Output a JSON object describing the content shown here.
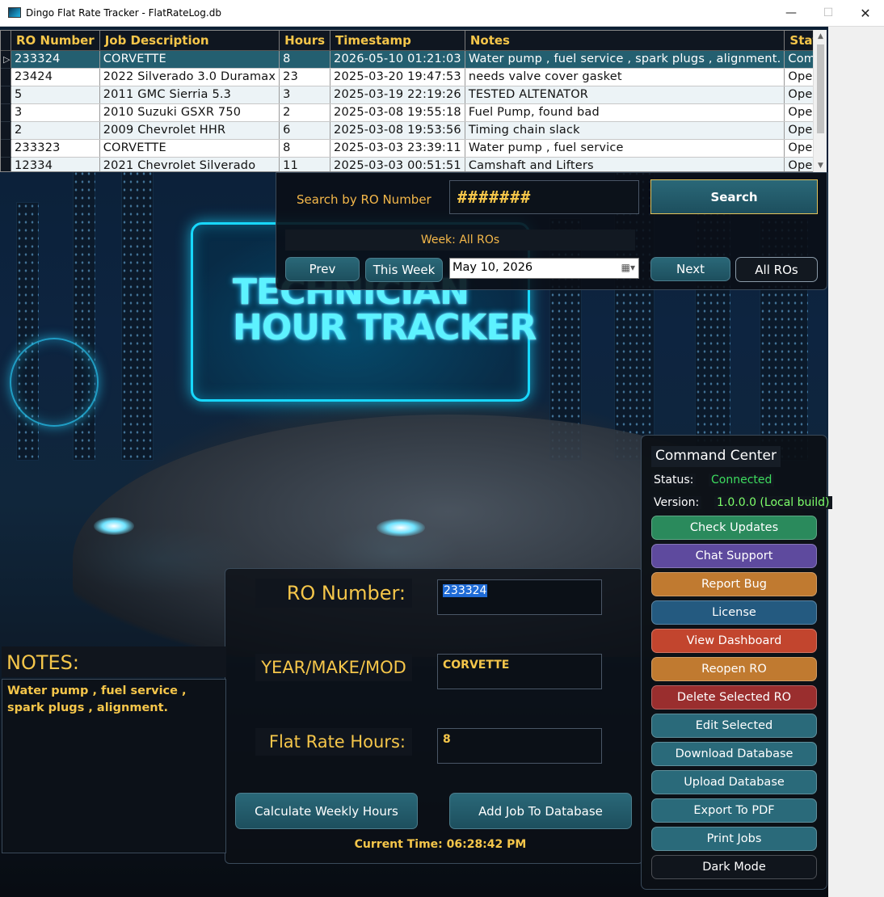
{
  "window": {
    "title": "Dingo Flat Rate Tracker - FlatRateLog.db",
    "minimize": "—",
    "maximize": "☐",
    "close": "✕"
  },
  "grid": {
    "columns": [
      "RO Number",
      "Job Description",
      "Hours",
      "Timestamp",
      "Notes",
      "Status"
    ],
    "rows": [
      [
        "233324",
        "CORVETTE",
        "8",
        "2026-05-10 01:21:03",
        "Water pump , fuel service , spark plugs , alignment.",
        "Complete"
      ],
      [
        "23424",
        "2022 Silverado 3.0 Duramax",
        "23",
        "2025-03-20 19:47:53",
        "needs valve cover gasket",
        "Open"
      ],
      [
        "5",
        "2011 GMC Sierria 5.3",
        "3",
        "2025-03-19 22:19:26",
        "TESTED ALTENATOR",
        "Open"
      ],
      [
        "3",
        "2010 Suzuki GSXR 750",
        "2",
        "2025-03-08 19:55:18",
        "Fuel Pump, found bad",
        "Open"
      ],
      [
        "2",
        "2009  Chevrolet HHR",
        "6",
        "2025-03-08 19:53:56",
        "Timing chain slack",
        "Open"
      ],
      [
        "233323",
        "CORVETTE",
        "8",
        "2025-03-03 23:39:11",
        "Water pump , fuel service",
        "Open"
      ],
      [
        "12334",
        "2021 Chevrolet Silverado",
        "11",
        "2025-03-03 00:51:51",
        "Camshaft and Lifters",
        "Open"
      ]
    ],
    "selected_row_marker": "▷"
  },
  "search": {
    "label": "Search by RO Number",
    "value": "#######",
    "button": "Search",
    "week_label": "Week: All ROs",
    "prev": "Prev",
    "this_week": "This Week",
    "date": "May 10, 2026",
    "next": "Next",
    "all_ros": "All ROs"
  },
  "hero": {
    "line1": "TECHNICIAN",
    "line2": "HOUR TRACKER"
  },
  "form": {
    "ro_label": "RO Number:",
    "ro_value": "233324",
    "ymm_label": "YEAR/MAKE/MOD",
    "ymm_value": "CORVETTE",
    "hours_label": "Flat Rate Hours:",
    "hours_value": "8",
    "calc_button": "Calculate Weekly Hours",
    "add_button": "Add Job To Database",
    "current_time": "Current Time: 06:28:42 PM"
  },
  "notes": {
    "title": "NOTES:",
    "text": "Water pump , fuel service , spark plugs , alignment."
  },
  "command_center": {
    "title": "Command Center",
    "status_label": "Status:",
    "status_value": "Connected",
    "version_label": "Version:",
    "version_value": "1.0.0.0 (Local build)",
    "buttons": [
      {
        "label": "Check Updates",
        "color": "#2a8a5c"
      },
      {
        "label": "Chat Support",
        "color": "#5e4a9e"
      },
      {
        "label": "Report Bug",
        "color": "#c07a30"
      },
      {
        "label": "License",
        "color": "#245a80"
      },
      {
        "label": "View Dashboard",
        "color": "#c2452e"
      },
      {
        "label": "Reopen RO",
        "color": "#c07a30"
      },
      {
        "label": "Delete Selected RO",
        "color": "#9a2e2e"
      },
      {
        "label": "Edit Selected",
        "color": "#2a6a7a"
      },
      {
        "label": "Download Database",
        "color": "#2a6a7a"
      },
      {
        "label": "Upload Database",
        "color": "#2a6a7a"
      },
      {
        "label": "Export To PDF",
        "color": "#2a6a7a"
      },
      {
        "label": "Print Jobs",
        "color": "#2a6a7a"
      },
      {
        "label": "Dark Mode",
        "color": "#10151c"
      }
    ]
  },
  "colors": {
    "accent_gold": "#f5c64a",
    "selected_row": "#245f70",
    "connected": "#3ddc5e",
    "version": "#7dff6a"
  }
}
